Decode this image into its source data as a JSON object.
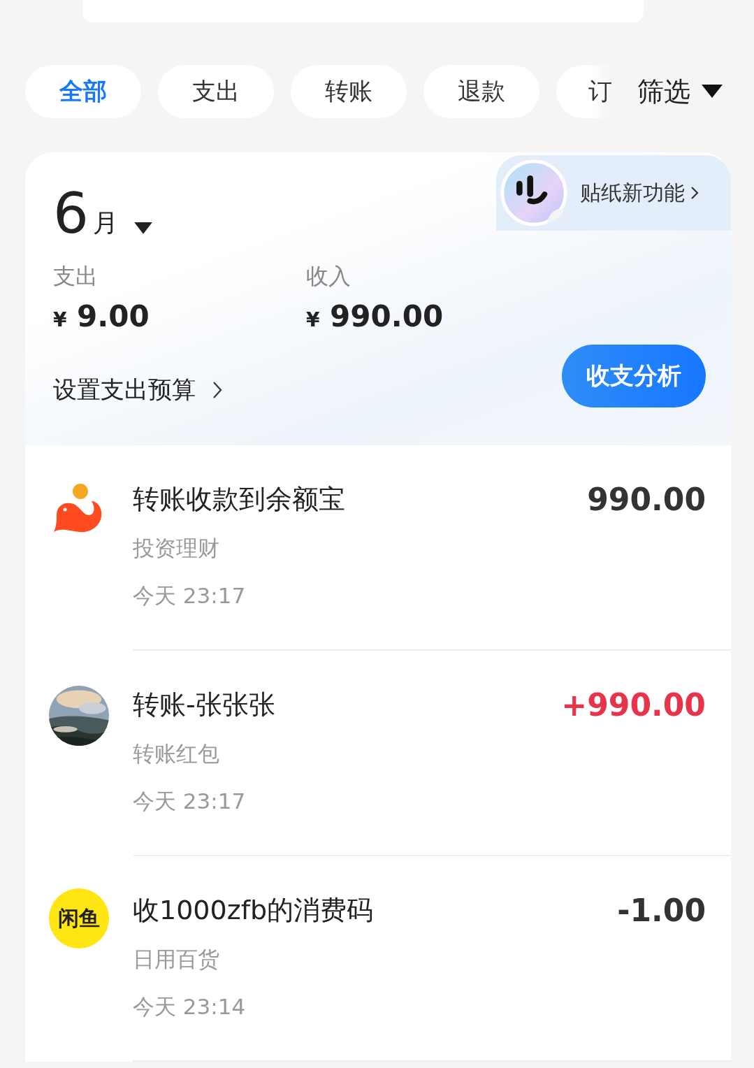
{
  "filters": [
    {
      "label": "全部",
      "selected": true
    },
    {
      "label": "支出",
      "selected": false
    },
    {
      "label": "转账",
      "selected": false
    },
    {
      "label": "退款",
      "selected": false
    },
    {
      "label": "订",
      "selected": false
    }
  ],
  "filter_button": {
    "label": "筛选"
  },
  "summary": {
    "month_number": "6",
    "month_unit": "月",
    "stats": [
      {
        "label": "支出",
        "currency": "¥",
        "amount": "9.00"
      },
      {
        "label": "收入",
        "currency": "¥",
        "amount": "990.00"
      }
    ],
    "budget_link": "设置支出预算",
    "analysis_button": "收支分析",
    "sticker_banner": "贴纸新功能"
  },
  "transactions": [
    {
      "avatar": {
        "kind": "fish"
      },
      "title": "转账收款到余额宝",
      "category": "投资理财",
      "time": "今天 23:17",
      "amount": "990.00",
      "color": "#333333"
    },
    {
      "title": "转账-张张张",
      "category": "转账红包",
      "time": "今天 23:17",
      "amount": "+990.00",
      "color": "#e8344a"
    },
    {
      "avatar": {
        "kind": "logo",
        "text": "闲鱼"
      },
      "title": "收1000zfb的消费码",
      "category": "日用百货",
      "time": "今天 23:14",
      "amount": "-1.00",
      "color": "#333333"
    }
  ]
}
